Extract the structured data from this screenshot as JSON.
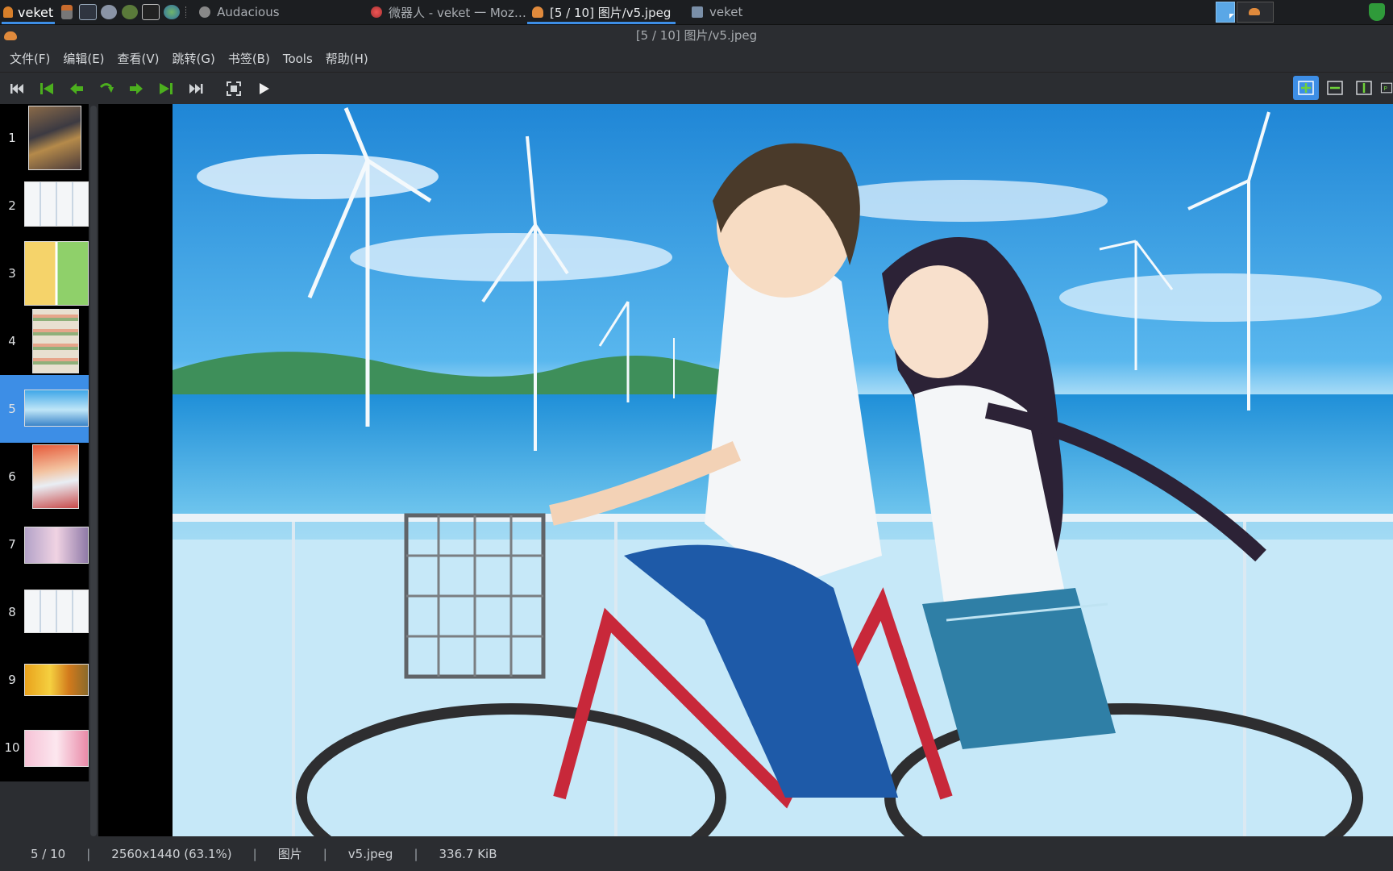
{
  "taskbar": {
    "app_label": "veket",
    "tasks": [
      {
        "label": "Audacious"
      },
      {
        "label": "微器人 - veket 一 Moz…"
      },
      {
        "label": "[5 / 10]  图片/v5.jpeg"
      },
      {
        "label": "veket"
      }
    ]
  },
  "window": {
    "title": "[5 / 10]  图片/v5.jpeg"
  },
  "menu": {
    "items": [
      "文件(F)",
      "编辑(E)",
      "查看(V)",
      "跳转(G)",
      "书签(B)",
      "Tools",
      "帮助(H)"
    ]
  },
  "toolbar": {
    "icons": [
      "first-page-icon",
      "previous-archive-icon",
      "previous-page-icon",
      "rotate-icon",
      "next-page-icon",
      "next-archive-icon",
      "last-page-icon",
      "fullscreen-icon",
      "slideshow-play-icon"
    ],
    "zoom_icons": [
      "best-fit-icon",
      "fit-width-icon",
      "fit-height-icon",
      "manual-zoom-icon"
    ]
  },
  "thumbnails": {
    "items": [
      {
        "num": "1"
      },
      {
        "num": "2"
      },
      {
        "num": "3"
      },
      {
        "num": "4"
      },
      {
        "num": "5"
      },
      {
        "num": "6"
      },
      {
        "num": "7"
      },
      {
        "num": "8"
      },
      {
        "num": "9"
      },
      {
        "num": "10"
      }
    ],
    "selected": "5"
  },
  "status": {
    "page": "5 / 10",
    "dimensions": "2560x1440 (63.1%)",
    "folder": "图片",
    "filename": "v5.jpeg",
    "filesize": "336.7 KiB"
  },
  "colors": {
    "accent": "#3d8ee6",
    "toolbar_green": "#4caf1e"
  }
}
